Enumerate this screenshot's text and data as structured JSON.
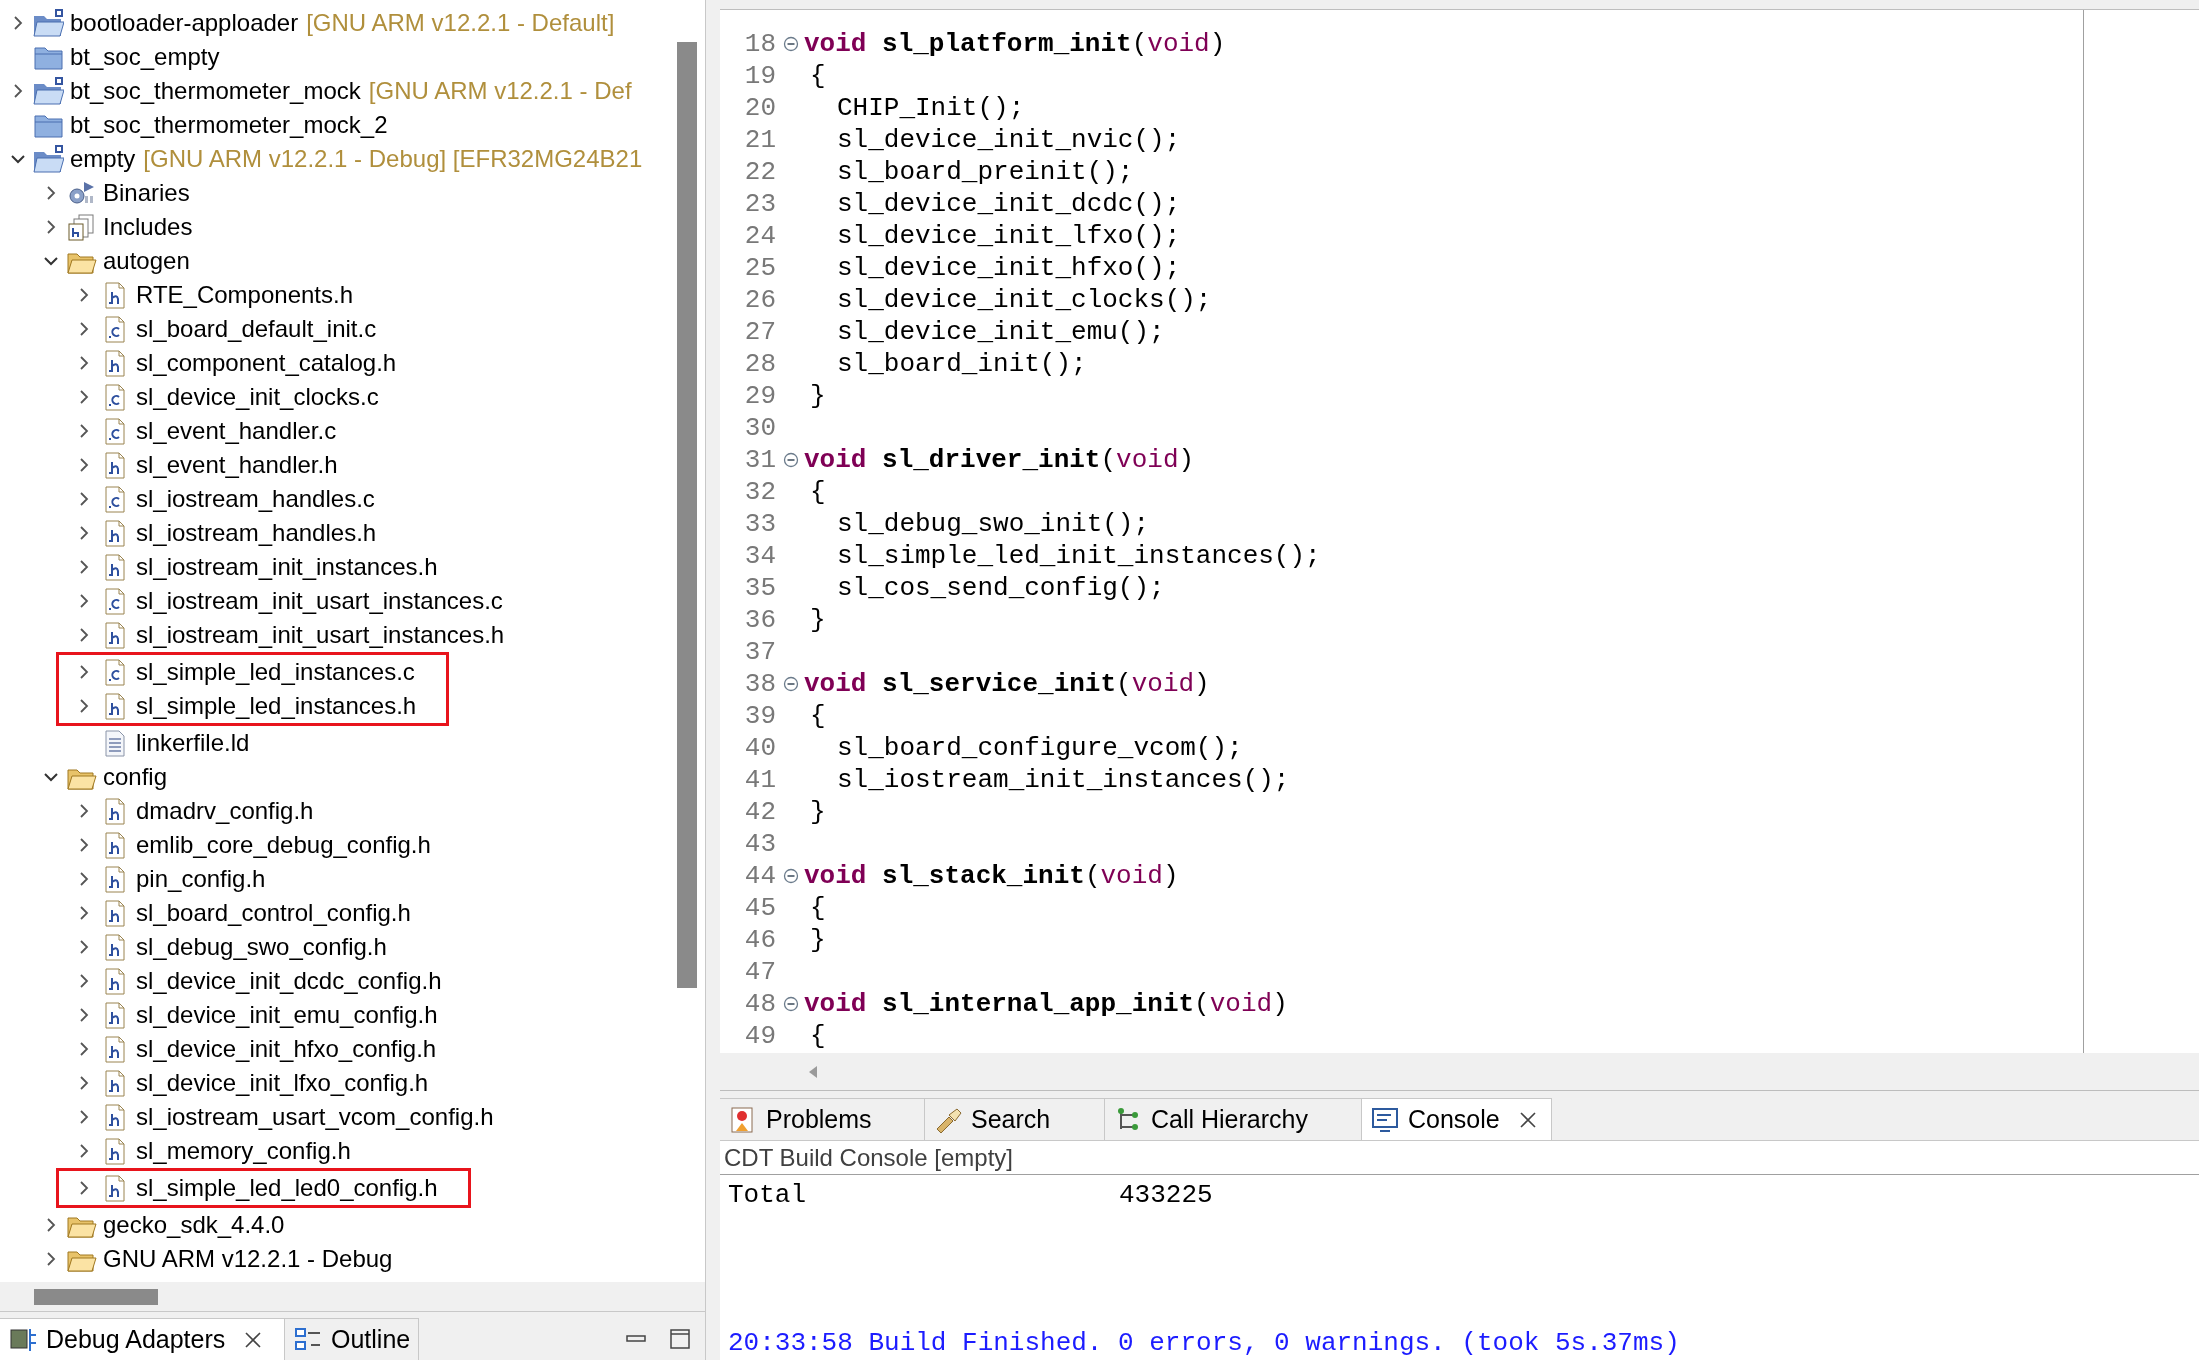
{
  "project_explorer": {
    "items": [
      {
        "label": "bootloader-apploader",
        "suffix": "[GNU ARM v12.2.1 - Default]",
        "kind": "project",
        "expanded": false
      },
      {
        "label": "bt_soc_empty",
        "kind": "closed-project"
      },
      {
        "label": "bt_soc_thermometer_mock",
        "suffix": "[GNU ARM v12.2.1 - Def",
        "kind": "project",
        "expanded": false
      },
      {
        "label": "bt_soc_thermometer_mock_2",
        "kind": "closed-project"
      },
      {
        "label": "empty",
        "suffix": "[GNU ARM v12.2.1 - Debug] [EFR32MG24B21",
        "kind": "project",
        "expanded": true,
        "children": [
          {
            "label": "Binaries",
            "kind": "binaries",
            "expanded": false
          },
          {
            "label": "Includes",
            "kind": "includes",
            "expanded": false
          },
          {
            "label": "autogen",
            "kind": "folder",
            "expanded": true,
            "children": [
              {
                "label": "RTE_Components.h",
                "kind": "h",
                "expanded": false,
                "highlighted": false
              },
              {
                "label": "sl_board_default_init.c",
                "kind": "c",
                "expanded": false,
                "highlighted": false
              },
              {
                "label": "sl_component_catalog.h",
                "kind": "h",
                "expanded": false,
                "highlighted": false
              },
              {
                "label": "sl_device_init_clocks.c",
                "kind": "c",
                "expanded": false,
                "highlighted": false
              },
              {
                "label": "sl_event_handler.c",
                "kind": "c",
                "expanded": false,
                "highlighted": false
              },
              {
                "label": "sl_event_handler.h",
                "kind": "h",
                "expanded": false,
                "highlighted": false
              },
              {
                "label": "sl_iostream_handles.c",
                "kind": "c",
                "expanded": false,
                "highlighted": false
              },
              {
                "label": "sl_iostream_handles.h",
                "kind": "h",
                "expanded": false,
                "highlighted": false
              },
              {
                "label": "sl_iostream_init_instances.h",
                "kind": "h",
                "expanded": false,
                "highlighted": false
              },
              {
                "label": "sl_iostream_init_usart_instances.c",
                "kind": "c",
                "expanded": false,
                "highlighted": false
              },
              {
                "label": "sl_iostream_init_usart_instances.h",
                "kind": "h",
                "expanded": false,
                "highlighted": false
              },
              {
                "label": "sl_simple_led_instances.c",
                "kind": "c",
                "expanded": false,
                "highlighted": true
              },
              {
                "label": "sl_simple_led_instances.h",
                "kind": "h",
                "expanded": false,
                "highlighted": true
              },
              {
                "label": "linkerfile.ld",
                "kind": "ld",
                "highlighted": false
              }
            ]
          },
          {
            "label": "config",
            "kind": "folder",
            "expanded": true,
            "children": [
              {
                "label": "dmadrv_config.h",
                "kind": "h",
                "expanded": false,
                "highlighted": false
              },
              {
                "label": "emlib_core_debug_config.h",
                "kind": "h",
                "expanded": false,
                "highlighted": false
              },
              {
                "label": "pin_config.h",
                "kind": "h",
                "expanded": false,
                "highlighted": false
              },
              {
                "label": "sl_board_control_config.h",
                "kind": "h",
                "expanded": false,
                "highlighted": false
              },
              {
                "label": "sl_debug_swo_config.h",
                "kind": "h",
                "expanded": false,
                "highlighted": false
              },
              {
                "label": "sl_device_init_dcdc_config.h",
                "kind": "h",
                "expanded": false,
                "highlighted": false
              },
              {
                "label": "sl_device_init_emu_config.h",
                "kind": "h",
                "expanded": false,
                "highlighted": false
              },
              {
                "label": "sl_device_init_hfxo_config.h",
                "kind": "h",
                "expanded": false,
                "highlighted": false
              },
              {
                "label": "sl_device_init_lfxo_config.h",
                "kind": "h",
                "expanded": false,
                "highlighted": false
              },
              {
                "label": "sl_iostream_usart_vcom_config.h",
                "kind": "h",
                "expanded": false,
                "highlighted": false
              },
              {
                "label": "sl_memory_config.h",
                "kind": "h",
                "expanded": false,
                "highlighted": false
              },
              {
                "label": "sl_simple_led_led0_config.h",
                "kind": "h",
                "expanded": false,
                "highlighted": true
              }
            ]
          },
          {
            "label": "gecko_sdk_4.4.0",
            "kind": "folder",
            "expanded": false
          },
          {
            "label": "GNU ARM v12.2.1 - Debug",
            "kind": "folder",
            "expanded": false
          }
        ]
      }
    ]
  },
  "left_bottom_tabs": [
    {
      "label": "Debug Adapters",
      "kind": "debug-adapters",
      "closable": true,
      "selected": true
    },
    {
      "label": "Outline",
      "kind": "outline",
      "closable": false,
      "selected": false
    }
  ],
  "editor": {
    "lines": [
      {
        "number": "18",
        "kind": "function",
        "keyword": "void",
        "name": "sl_platform_init",
        "open": "(",
        "param": "void",
        "close": ")"
      },
      {
        "number": "19",
        "kind": "brace",
        "text": "{"
      },
      {
        "number": "20",
        "kind": "statement",
        "text": "CHIP_Init();"
      },
      {
        "number": "21",
        "kind": "statement",
        "text": "sl_device_init_nvic();"
      },
      {
        "number": "22",
        "kind": "statement",
        "text": "sl_board_preinit();"
      },
      {
        "number": "23",
        "kind": "statement",
        "text": "sl_device_init_dcdc();"
      },
      {
        "number": "24",
        "kind": "statement",
        "text": "sl_device_init_lfxo();"
      },
      {
        "number": "25",
        "kind": "statement",
        "text": "sl_device_init_hfxo();"
      },
      {
        "number": "26",
        "kind": "statement",
        "text": "sl_device_init_clocks();"
      },
      {
        "number": "27",
        "kind": "statement",
        "text": "sl_device_init_emu();"
      },
      {
        "number": "28",
        "kind": "statement",
        "text": "sl_board_init();"
      },
      {
        "number": "29",
        "kind": "brace",
        "text": "}"
      },
      {
        "number": "30",
        "kind": "blank"
      },
      {
        "number": "31",
        "kind": "function",
        "keyword": "void",
        "name": "sl_driver_init",
        "open": "(",
        "param": "void",
        "close": ")"
      },
      {
        "number": "32",
        "kind": "brace",
        "text": "{"
      },
      {
        "number": "33",
        "kind": "statement",
        "text": "sl_debug_swo_init();"
      },
      {
        "number": "34",
        "kind": "statement",
        "text": "sl_simple_led_init_instances();"
      },
      {
        "number": "35",
        "kind": "statement",
        "text": "sl_cos_send_config();"
      },
      {
        "number": "36",
        "kind": "brace",
        "text": "}"
      },
      {
        "number": "37",
        "kind": "blank"
      },
      {
        "number": "38",
        "kind": "function",
        "keyword": "void",
        "name": "sl_service_init",
        "open": "(",
        "param": "void",
        "close": ")"
      },
      {
        "number": "39",
        "kind": "brace",
        "text": "{"
      },
      {
        "number": "40",
        "kind": "statement",
        "text": "sl_board_configure_vcom();"
      },
      {
        "number": "41",
        "kind": "statement",
        "text": "sl_iostream_init_instances();"
      },
      {
        "number": "42",
        "kind": "brace",
        "text": "}"
      },
      {
        "number": "43",
        "kind": "blank"
      },
      {
        "number": "44",
        "kind": "function",
        "keyword": "void",
        "name": "sl_stack_init",
        "open": "(",
        "param": "void",
        "close": ")"
      },
      {
        "number": "45",
        "kind": "brace",
        "text": "{"
      },
      {
        "number": "46",
        "kind": "brace",
        "text": "}"
      },
      {
        "number": "47",
        "kind": "blank"
      },
      {
        "number": "48",
        "kind": "function",
        "keyword": "void",
        "name": "sl_internal_app_init",
        "open": "(",
        "param": "void",
        "close": ")"
      },
      {
        "number": "49",
        "kind": "brace",
        "text": "{"
      }
    ]
  },
  "bottom_tabs": [
    {
      "label": "Problems",
      "kind": "problems",
      "closable": false,
      "selected": false
    },
    {
      "label": "Search",
      "kind": "search",
      "closable": false,
      "selected": false
    },
    {
      "label": "Call Hierarchy",
      "kind": "call-hierarchy",
      "closable": false,
      "selected": false
    },
    {
      "label": "Console",
      "kind": "console",
      "closable": true,
      "selected": true
    }
  ],
  "console": {
    "title": "CDT Build Console [empty]",
    "total_label": "Total",
    "total_value": "433225",
    "status": "20:33:58 Build Finished. 0 errors, 0 warnings. (took 5s.37ms)"
  }
}
